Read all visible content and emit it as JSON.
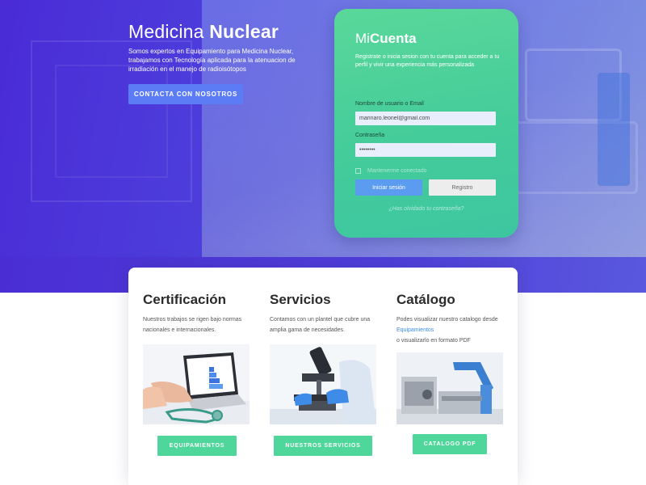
{
  "hero": {
    "title_light": "Medicina ",
    "title_bold": "Nuclear",
    "description": "Somos expertos en Equipamiento para Medicina Nuclear, trabajamos con Tecnología aplicada para la atenuacion de irradiación en el manejo de radioisótopos",
    "cta_label": "CONTACTA CON NOSOTROS"
  },
  "login": {
    "title_light": "Mi",
    "title_bold": "Cuenta",
    "description": "Registrate o inicia sesion con tu cuenta para acceder a tu perfil y vivir una experiencia más personalizada",
    "username_label": "Nombre de usuario o Email",
    "username_value": "marinaro.leonel@gmail.com",
    "password_label": "Contraseña",
    "password_value": "••••••••",
    "remember_label": "Mantenerme conectado",
    "login_button": "Iniciar sesión",
    "register_button": "Registro",
    "forgot_link": "¿Has olvidado tu contraseña?"
  },
  "sections": {
    "certificacion": {
      "title": "Certificación",
      "description": "Nuestros trabajos se rigen bajo normas nacionales e internacionales.",
      "button": "EQUIPAMIENTOS"
    },
    "servicios": {
      "title": "Servicios",
      "description": "Contamos con un plantel que cubre una amplia gama de necesidades.",
      "button": "NUESTROS SERVICIOS"
    },
    "catalogo": {
      "title": "Catálogo",
      "description_1": "Podes visualizar nuestro catalogo desde ",
      "description_link": "Equipamientos",
      "description_2": "o visualizarlo en formato PDF",
      "button": "CATALOGO PDF"
    }
  },
  "colors": {
    "hero_purple": "#4a2bd6",
    "login_green": "#44cc9a",
    "cta_blue": "#5b7cf5",
    "section_button_green": "#4fd79b",
    "link_blue": "#3b8de8"
  }
}
